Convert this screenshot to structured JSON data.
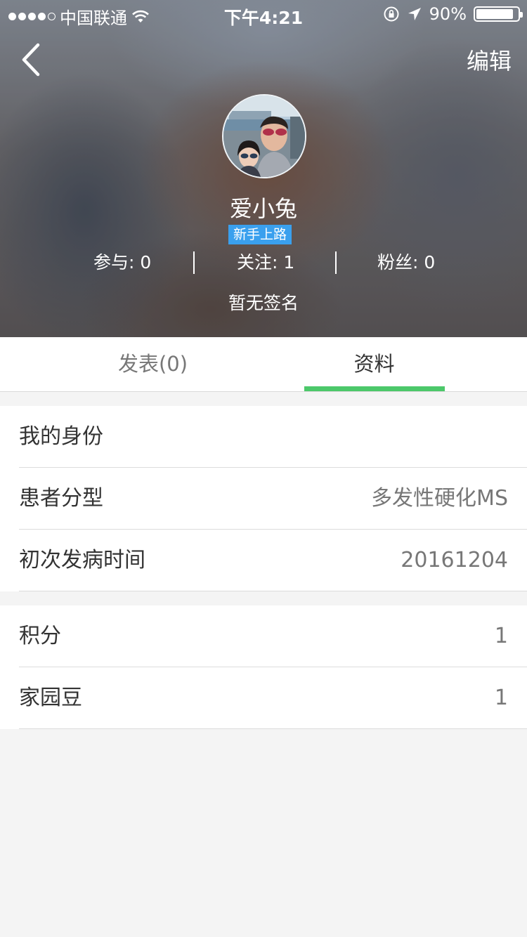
{
  "status_bar": {
    "carrier": "中国联通",
    "time": "下午4:21",
    "battery": "90%",
    "battery_level": 0.9,
    "signal_bars_filled": 4,
    "signal_bars_total": 5
  },
  "nav": {
    "back_icon": "chevron-left-icon",
    "edit_label": "编辑"
  },
  "profile": {
    "username": "爱小兔",
    "badge": "新手上路",
    "badge_color": "#3aa0ee",
    "stats": {
      "participate": "参与: 0",
      "following": "关注: 1",
      "fans": "粉丝: 0"
    },
    "signature": "暂无签名"
  },
  "tabs": {
    "posts": "发表(0)",
    "profile_info": "资料",
    "active": "资料",
    "indicator_color": "#4cc86a"
  },
  "info_group": [
    {
      "label": "我的身份",
      "value": ""
    },
    {
      "label": "患者分型",
      "value": "多发性硬化MS"
    },
    {
      "label": "初次发病时间",
      "value": "20161204"
    }
  ],
  "points_group": [
    {
      "label": "积分",
      "value": "1"
    },
    {
      "label": "家园豆",
      "value": "1"
    }
  ]
}
